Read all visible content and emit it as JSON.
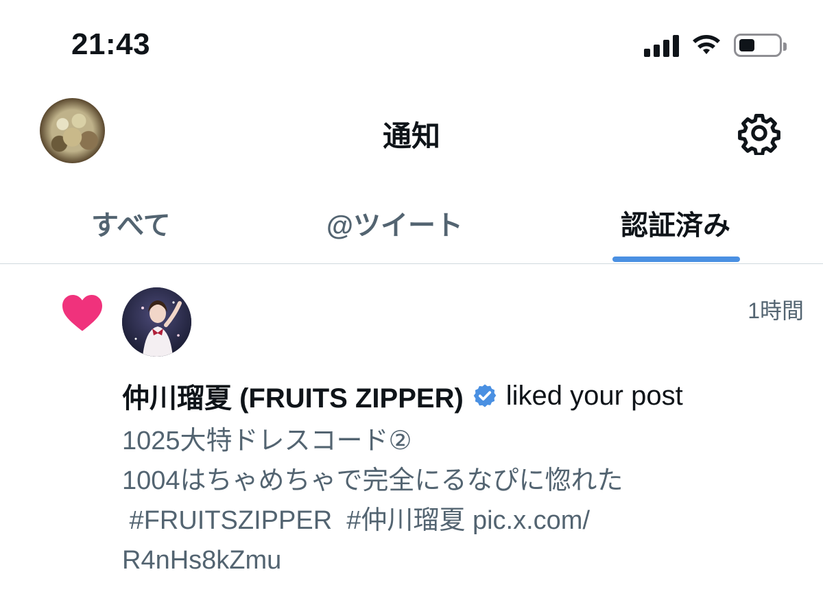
{
  "status_bar": {
    "time": "21:43",
    "icons": [
      "cellular-signal-icon",
      "wifi-icon",
      "battery-icon"
    ]
  },
  "header": {
    "title": "通知",
    "left_icon": "profile-avatar",
    "right_icon": "gear-icon"
  },
  "tabs": [
    {
      "label": "すべて",
      "active": false
    },
    {
      "label": "@ツイート",
      "active": false
    },
    {
      "label": "認証済み",
      "active": true
    }
  ],
  "notification": {
    "type_icon": "heart-icon",
    "timestamp": "1時間",
    "user_name": "仲川瑠夏 (FRUITS ZIPPER)",
    "verified": true,
    "action": "liked your post",
    "post_lines": [
      "1025大特ドレスコード②",
      "1004はちゃめちゃで完全にるなぴに惚れた",
      " #FRUITSZIPPER  #仲川瑠夏 pic.x.com/",
      "R4nHs8kZmu"
    ]
  },
  "colors": {
    "accent": "#4a90e2",
    "heart": "#f91880",
    "secondary_text": "#536471",
    "primary_text": "#0f1419"
  }
}
